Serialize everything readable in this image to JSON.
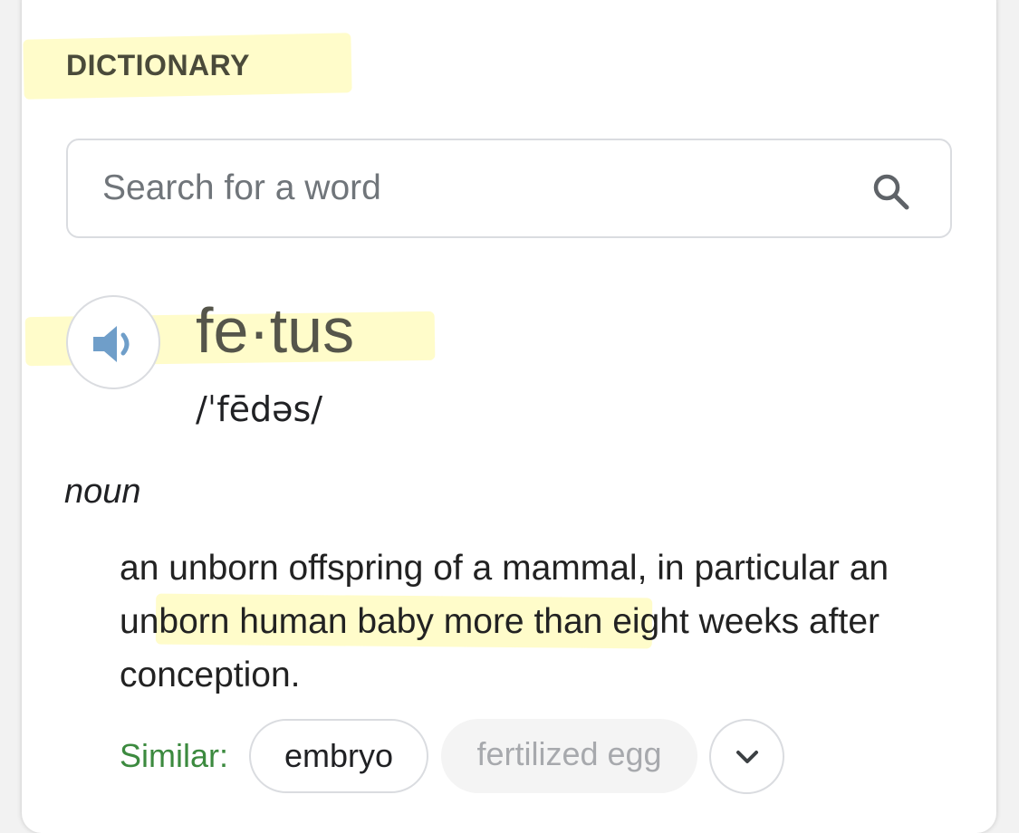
{
  "dictionary": {
    "section_title": "DICTIONARY",
    "search": {
      "placeholder": "Search for a word",
      "value": "",
      "icon": "search-icon"
    },
    "entry": {
      "pronounce_icon": "speaker-icon",
      "headword": "fe·tus",
      "phonetic": "/ˈfēdəs/",
      "part_of_speech": "noun",
      "definition": "an unborn offspring of a mammal, in particular an unborn human baby more than eight weeks after conception.",
      "similar_label": "Similar:",
      "similar_words": [
        "embryo",
        "fertilized egg"
      ],
      "expand_icon": "chevron-down-icon"
    }
  },
  "colors": {
    "highlight": "#fffa96",
    "similar_label": "#3c8a3f",
    "speaker_icon": "#6f9ec9"
  }
}
